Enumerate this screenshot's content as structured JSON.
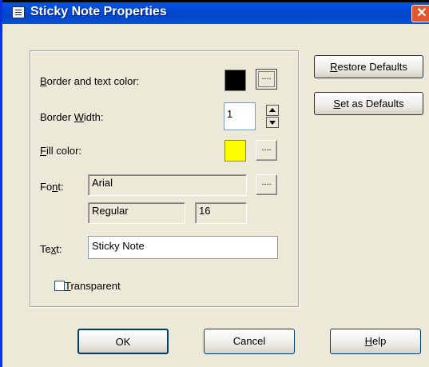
{
  "window": {
    "title": "Sticky Note Properties",
    "close_glyph": "✕"
  },
  "labels": {
    "border_text_color": {
      "pre": "",
      "key": "B",
      "post": "order and text color:"
    },
    "border_width": {
      "pre": "Border ",
      "key": "W",
      "post": "idth:"
    },
    "fill_color": {
      "pre": "",
      "key": "F",
      "post": "ill color:"
    },
    "font": {
      "pre": "Fo",
      "key": "n",
      "post": "t:"
    },
    "text": {
      "pre": "Te",
      "key": "x",
      "post": "t:"
    },
    "transparent": {
      "pre": "",
      "key": "T",
      "post": "ransparent"
    }
  },
  "values": {
    "border_width": "1",
    "font_name": "Arial",
    "font_style": "Regular",
    "font_size": "16",
    "text": "Sticky Note",
    "transparent_checked": false
  },
  "colors": {
    "border_text_color": "#000000",
    "fill_color": "#ffff00"
  },
  "buttons": {
    "ellipsis": "....",
    "restore_defaults": {
      "pre": "",
      "key": "R",
      "post": "estore Defaults"
    },
    "set_as_defaults": {
      "pre": "",
      "key": "S",
      "post": "et as Defaults"
    },
    "ok": "OK",
    "cancel": "Cancel",
    "help": {
      "pre": "",
      "key": "H",
      "post": "elp"
    }
  },
  "icons": {
    "app": "properties-dialog-icon",
    "spin_up": "triangle-up-icon",
    "spin_down": "triangle-down-icon"
  }
}
